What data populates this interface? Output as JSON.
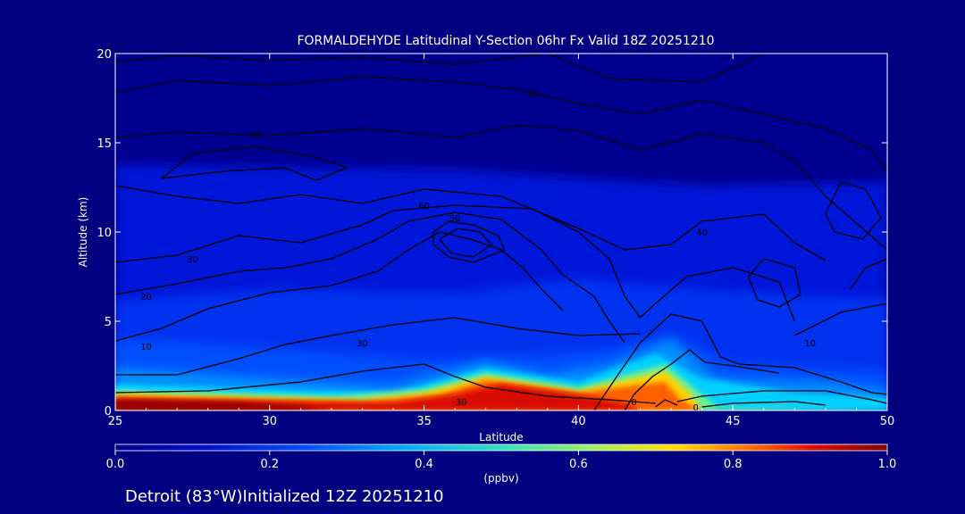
{
  "chart_data": {
    "type": "heatmap",
    "title": "FORMALDEHYDE Latitudinal Y-Section 06hr  Fx Valid 18Z 20251210",
    "xlabel": "Latitude",
    "ylabel": "Altitude (km)",
    "xlim": [
      25,
      50
    ],
    "ylim": [
      0,
      20
    ],
    "x_ticks": [
      "25",
      "30",
      "35",
      "40",
      "45",
      "50"
    ],
    "y_ticks": [
      "0",
      "5",
      "10",
      "15",
      "20"
    ],
    "colorbar": {
      "min": 0.0,
      "max": 1.0,
      "ticks": [
        "0.0",
        "0.2",
        "0.4",
        "0.6",
        "0.8",
        "1.0"
      ],
      "units": "(ppbv)"
    },
    "fill": {
      "latitudes": [
        25,
        27,
        29,
        31,
        33,
        35,
        36,
        37,
        38,
        39,
        40,
        41,
        42,
        43,
        44,
        45,
        46,
        48,
        50
      ],
      "altitudes": [
        0,
        0.5,
        1,
        1.5,
        2,
        2.5,
        3,
        4,
        5,
        6,
        8,
        10,
        12,
        14,
        16,
        18,
        20
      ],
      "note_values": "peak HCHO near surface south of 35N and plume near 36-38N at 1.5 km and near 43N"
    },
    "contour_labels": [
      "0",
      "10",
      "20",
      "30",
      "40",
      "50",
      "60",
      "70"
    ],
    "contours": [
      {
        "level": "0",
        "lat": 43.8,
        "alt": 0.2
      },
      {
        "level": "0",
        "lat": 41.8,
        "alt": 0.5
      },
      {
        "level": "10",
        "lat": 26.0,
        "alt": 3.6
      },
      {
        "level": "20",
        "lat": 26.0,
        "alt": 6.4
      },
      {
        "level": "30",
        "lat": 27.5,
        "alt": 8.5
      },
      {
        "level": "30",
        "lat": 33.0,
        "alt": 3.8
      },
      {
        "level": "40",
        "lat": 29.5,
        "alt": 15.5
      },
      {
        "level": "40",
        "lat": 44.0,
        "alt": 10.0
      },
      {
        "level": "50",
        "lat": 36.0,
        "alt": 10.8
      },
      {
        "level": "60",
        "lat": 35.0,
        "alt": 11.5
      },
      {
        "level": "70",
        "lat": 38.5,
        "alt": 17.8
      },
      {
        "level": "10",
        "lat": 47.5,
        "alt": 3.8
      },
      {
        "level": "30",
        "lat": 36.2,
        "alt": 0.5
      }
    ]
  },
  "footer": {
    "location": "Detroit (83°W)Initialized 12Z 20251210"
  }
}
